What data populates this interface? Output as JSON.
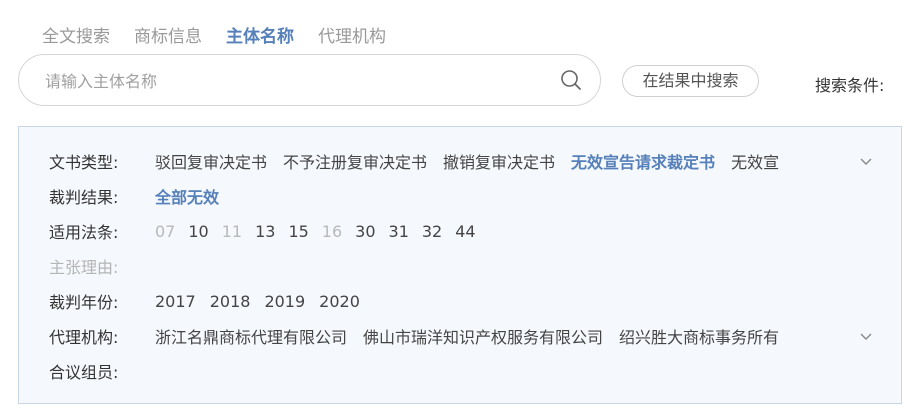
{
  "tabs": [
    {
      "label": "全文搜索",
      "active": false
    },
    {
      "label": "商标信息",
      "active": false
    },
    {
      "label": "主体名称",
      "active": true
    },
    {
      "label": "代理机构",
      "active": false
    }
  ],
  "search": {
    "placeholder": "请输入主体名称",
    "value": "",
    "icon": "search-icon",
    "in_results_button": "在结果中搜索",
    "criteria_label": "搜索条件:"
  },
  "filters": {
    "doc_type": {
      "label": "文书类型:",
      "options": [
        "驳回复审决定书",
        "不予注册复审决定书",
        "撤销复审决定书",
        "无效宣告请求裁定书",
        "无效宣"
      ],
      "active_index": 3
    },
    "result": {
      "label": "裁判结果:",
      "options": [
        "全部无效"
      ],
      "active_index": 0
    },
    "law": {
      "label": "适用法条:",
      "options": [
        "07",
        "10",
        "11",
        "13",
        "15",
        "16",
        "30",
        "31",
        "32",
        "44"
      ],
      "dim_indices": [
        0,
        2,
        5
      ]
    },
    "reason": {
      "label": "主张理由:",
      "disabled": true
    },
    "year": {
      "label": "裁判年份:",
      "options": [
        "2017",
        "2018",
        "2019",
        "2020"
      ]
    },
    "agency": {
      "label": "代理机构:",
      "options": [
        "浙江名鼎商标代理有限公司",
        "佛山市瑞洋知识产权服务有限公司",
        "绍兴胜大商标事务所有"
      ]
    },
    "panel_members": {
      "label": "合议组员:"
    }
  },
  "colors": {
    "accent": "#5680b9",
    "panel_bg": "#f5f8fc",
    "panel_border": "#c9d6e6",
    "dim_text": "#b8b8b8"
  }
}
